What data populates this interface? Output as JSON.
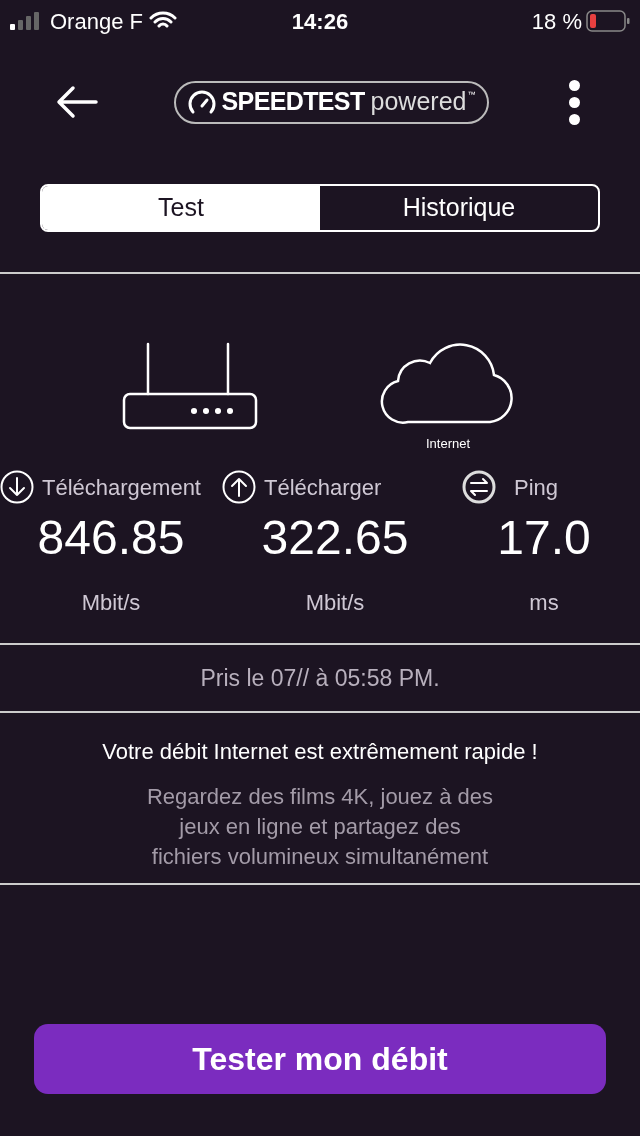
{
  "status_bar": {
    "carrier": "Orange F",
    "time": "14:26",
    "battery": "18 %"
  },
  "header": {
    "logo": {
      "brand": "SPEEDTEST",
      "suffix": "powered",
      "mark": "™"
    }
  },
  "tabs": [
    {
      "label": "Test",
      "selected": true
    },
    {
      "label": "Historique",
      "selected": false
    }
  ],
  "devices": {
    "server_label": "Internet"
  },
  "metrics": [
    {
      "kind": "download",
      "label": "Téléchargement",
      "value": "846.85",
      "unit": "Mbit/s"
    },
    {
      "kind": "upload",
      "label": "Télécharger",
      "value": "322.65",
      "unit": "Mbit/s"
    },
    {
      "kind": "ping",
      "label": "Ping",
      "value": "17.0",
      "unit": "ms"
    }
  ],
  "timestamp": "Pris le 07// à 05:58 PM.",
  "verdict": {
    "title": "Votre débit Internet est extrêmement rapide !",
    "lines": [
      "Regardez des films 4K, jouez à des",
      "jeux en ligne et partagez des",
      "fichiers volumineux simultanément"
    ]
  },
  "action_button": "Tester mon débit"
}
